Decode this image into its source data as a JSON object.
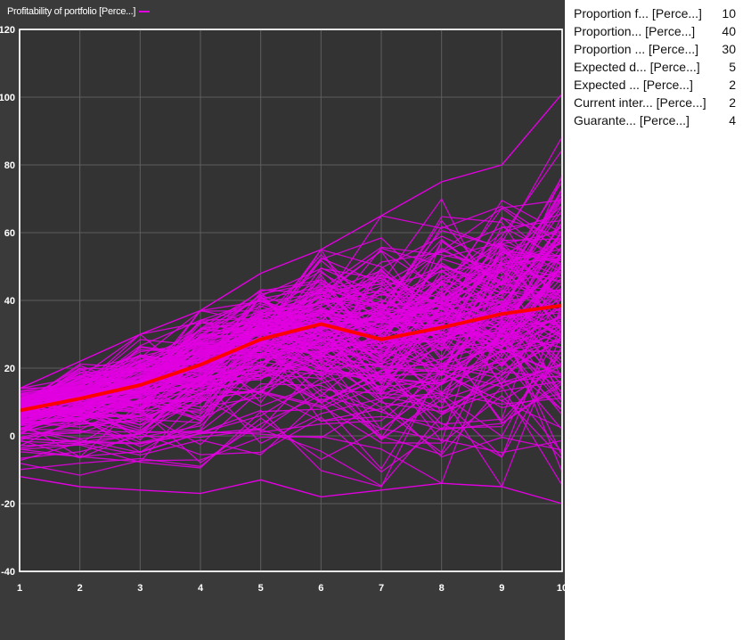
{
  "chart_data": {
    "type": "line",
    "title": "",
    "legend": {
      "label": "Profitability of portfolio [Perce...]",
      "color": "#e000e0",
      "placement": "top-left"
    },
    "x": [
      1,
      2,
      3,
      4,
      5,
      6,
      7,
      8,
      9,
      10
    ],
    "xlim": [
      1,
      10
    ],
    "ylim": [
      -40,
      120
    ],
    "y_ticks": [
      -40,
      -20,
      0,
      20,
      40,
      60,
      80,
      100,
      120
    ],
    "x_ticks": [
      1,
      2,
      3,
      4,
      5,
      6,
      7,
      8,
      9,
      10
    ],
    "grid": true,
    "background": "#333333",
    "series": [
      {
        "name": "Profitability of portfolio [Perce...]",
        "color": "#ff0000",
        "values": [
          7.5,
          11,
          15,
          21,
          28.5,
          33,
          28.5,
          32,
          36,
          38.5
        ]
      }
    ],
    "simulation_color": "#e000e0",
    "simulation_envelope": {
      "upper": [
        14,
        22,
        30,
        37,
        48,
        55,
        65,
        75,
        80,
        101
      ],
      "lower": [
        -12,
        -15,
        -16,
        -17,
        -13,
        -18,
        -16,
        -14,
        -15,
        -20
      ]
    }
  },
  "parameters": [
    {
      "label": "Proportion f... [Perce...]",
      "value": "10"
    },
    {
      "label": "Proportion... [Perce...]",
      "value": "40"
    },
    {
      "label": "Proportion ... [Perce...]",
      "value": "30"
    },
    {
      "label": "Expected d... [Perce...]",
      "value": "5"
    },
    {
      "label": "Expected ... [Perce...]",
      "value": "2"
    },
    {
      "label": "Current inter... [Perce...]",
      "value": "2"
    },
    {
      "label": "Guarante... [Perce...]",
      "value": "4"
    }
  ]
}
